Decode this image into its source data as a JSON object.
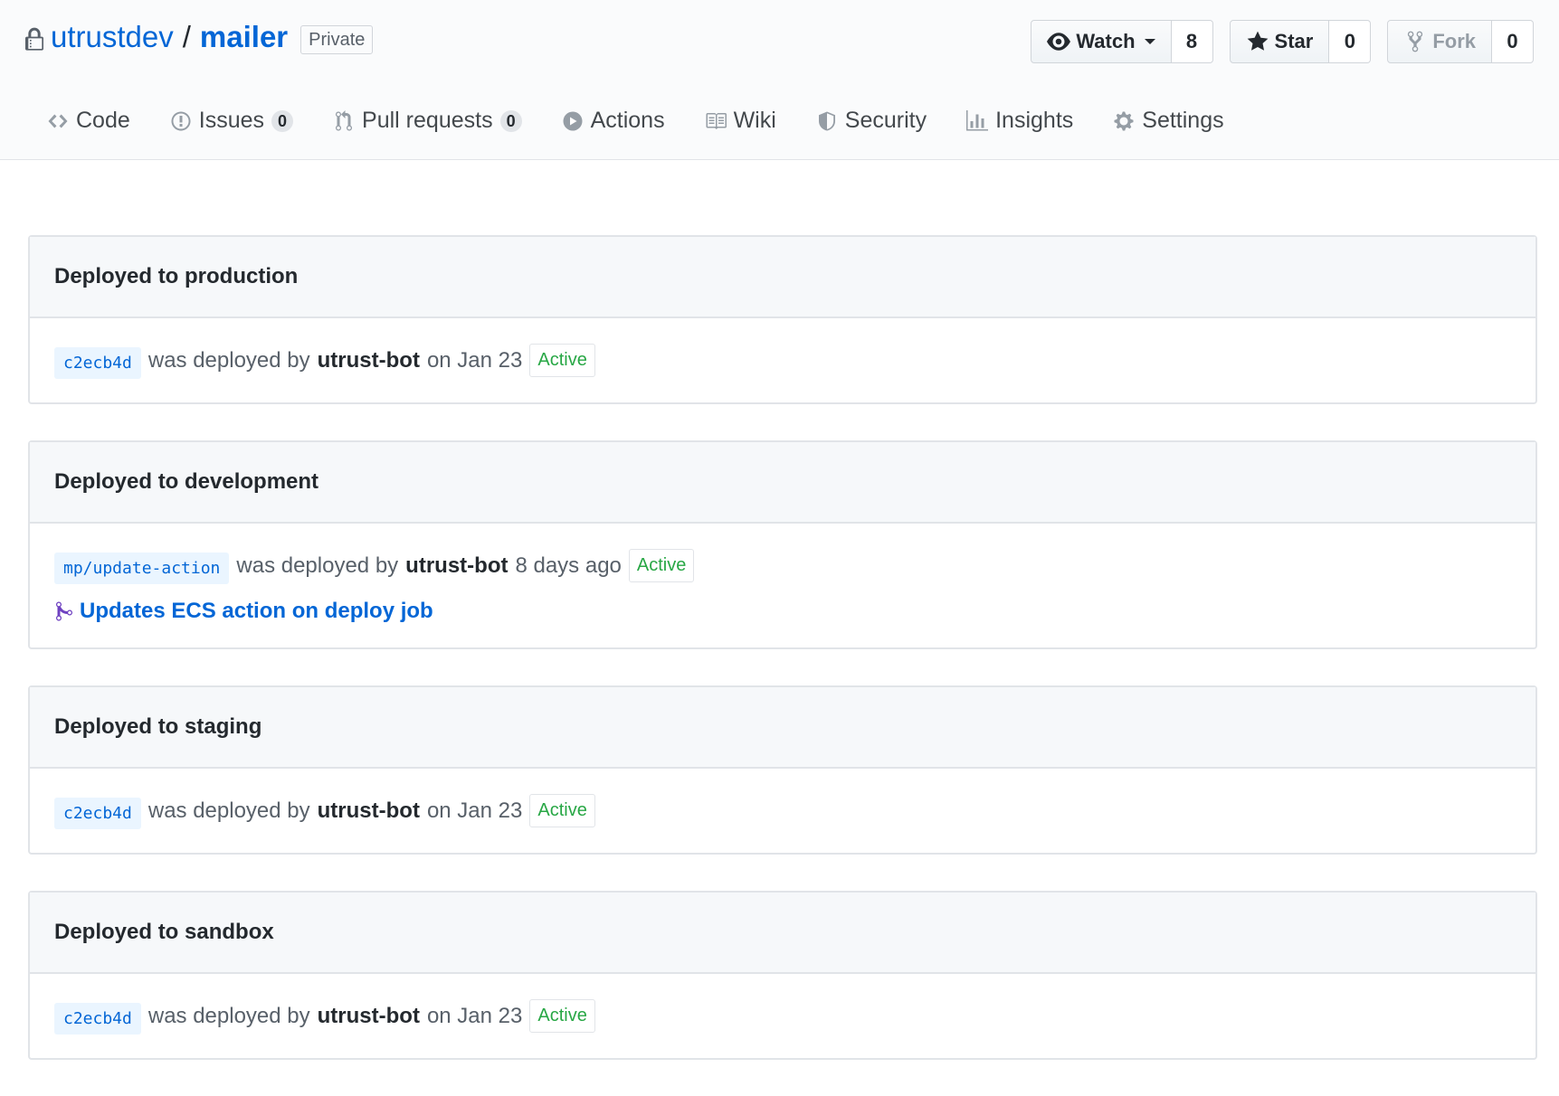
{
  "repo": {
    "owner": "utrustdev",
    "separator": "/",
    "name": "mailer",
    "visibility": "Private"
  },
  "actions": {
    "watch": {
      "label": "Watch",
      "count": "8"
    },
    "star": {
      "label": "Star",
      "count": "0"
    },
    "fork": {
      "label": "Fork",
      "count": "0"
    }
  },
  "tabs": [
    {
      "label": "Code",
      "icon": "code-icon"
    },
    {
      "label": "Issues",
      "count": "0",
      "icon": "issue-icon"
    },
    {
      "label": "Pull requests",
      "count": "0",
      "icon": "pull-request-icon"
    },
    {
      "label": "Actions",
      "icon": "play-icon"
    },
    {
      "label": "Wiki",
      "icon": "book-icon"
    },
    {
      "label": "Security",
      "icon": "shield-icon"
    },
    {
      "label": "Insights",
      "icon": "graph-icon"
    },
    {
      "label": "Settings",
      "icon": "gear-icon"
    }
  ],
  "deployments": [
    {
      "title": "Deployed to production",
      "ref": "c2ecb4d",
      "middle": "was deployed by",
      "user": "utrust-bot",
      "when": "on Jan 23",
      "status": "Active"
    },
    {
      "title": "Deployed to development",
      "ref": "mp/update-action",
      "middle": "was deployed by",
      "user": "utrust-bot",
      "when": "8 days ago",
      "status": "Active",
      "pr_title": "Updates ECS action on deploy job"
    },
    {
      "title": "Deployed to staging",
      "ref": "c2ecb4d",
      "middle": "was deployed by",
      "user": "utrust-bot",
      "when": "on Jan 23",
      "status": "Active"
    },
    {
      "title": "Deployed to sandbox",
      "ref": "c2ecb4d",
      "middle": "was deployed by",
      "user": "utrust-bot",
      "when": "on Jan 23",
      "status": "Active"
    }
  ],
  "colors": {
    "link": "#0366d6",
    "active": "#28a745",
    "header_bg": "#fafbfc",
    "merged": "#6f42c1"
  }
}
